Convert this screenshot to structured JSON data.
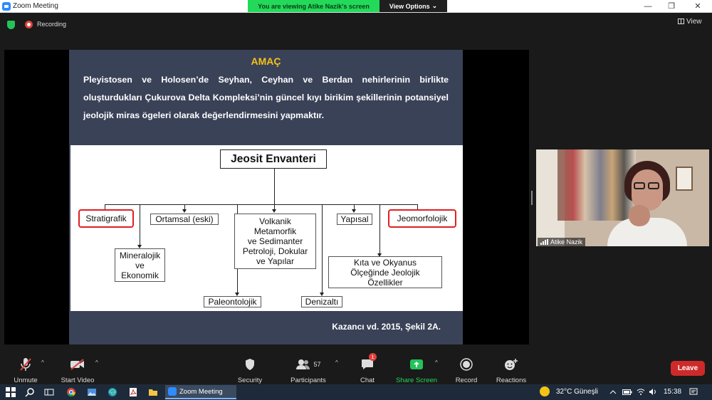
{
  "window": {
    "title": "Zoom Meeting"
  },
  "banner": {
    "viewing": "You are viewing Atike Nazik's screen",
    "view_options": "View Options",
    "chevron": "⌄"
  },
  "window_controls": {
    "minimize": "—",
    "restore": "❐",
    "close": "✕"
  },
  "status": {
    "recording": "Recording",
    "view": "View"
  },
  "slide": {
    "heading": "AMAÇ",
    "paragraph": "Pleyistosen ve Holosen’de Seyhan, Ceyhan ve Berdan nehirlerinin birlikte oluşturdukları Çukurova Delta Kompleksi’nin güncel kıyı birikim şekillerinin potansiyel jeolojik miras ögeleri olarak değerlendirmesini yapmaktır.",
    "citation": "Kazancı vd. 2015, Şekil 2A."
  },
  "diagram": {
    "root": "Jeosit Envanteri",
    "stratigrafik": "Stratigrafik",
    "ortamsal": "Ortamsal (eski)",
    "volkanik": "Volkanik\nMetamorfik\nve Sedimanter\nPetroloji, Dokular\nve Yapılar",
    "yapisal": "Yapısal",
    "jeomorfolojik": "Jeomorfolojik",
    "mineralojik": "Mineralojik\nve\nEkonomik",
    "paleontolojik": "Paleontolojik",
    "denizalti": "Denizaltı",
    "kita": "Kıta ve Okyanus\nÖlçeğinde Jeolojik\nÖzellikler"
  },
  "video": {
    "name": "Atike Nazik"
  },
  "toolbar": {
    "unmute": "Unmute",
    "start_video": "Start Video",
    "security": "Security",
    "participants": "Participants",
    "participants_count": "57",
    "chat": "Chat",
    "chat_badge": "1",
    "share_screen": "Share Screen",
    "record": "Record",
    "reactions": "Reactions",
    "leave": "Leave",
    "caret": "^"
  },
  "taskbar": {
    "app": "Zoom Meeting",
    "weather": "32°C Güneşli",
    "time": "15:38"
  },
  "colors": {
    "accent_green": "#23d959",
    "leave_red": "#cf2a2a",
    "slide_bg": "#3a4258",
    "heading_yellow": "#f5c216"
  }
}
